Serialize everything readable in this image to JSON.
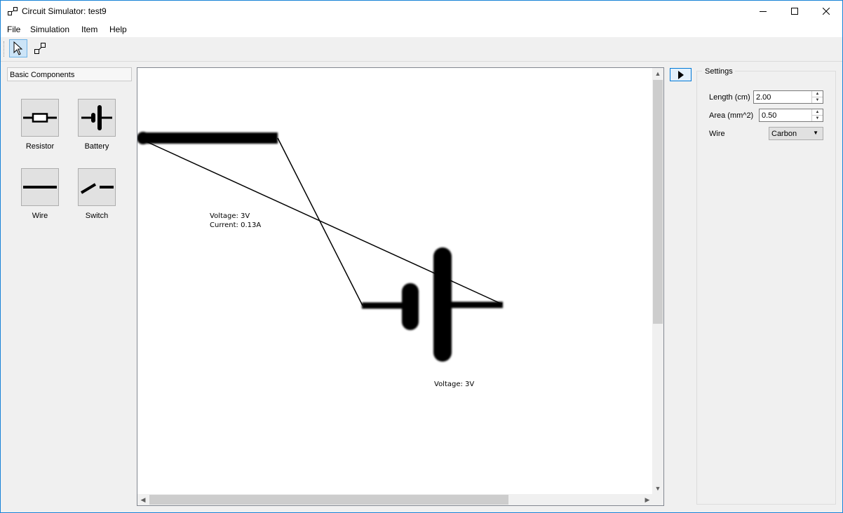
{
  "window": {
    "title": "Circuit Simulator: test9",
    "controls": [
      "minimize-icon",
      "maximize-icon",
      "close-icon"
    ]
  },
  "menu": {
    "items": [
      "File",
      "Simulation",
      "Item",
      "Help"
    ]
  },
  "toolbar": {
    "tools": [
      {
        "icon": "pointer-icon",
        "active": true
      },
      {
        "icon": "connect-icon",
        "active": false
      }
    ]
  },
  "components": {
    "header": "Basic Components",
    "items": [
      {
        "label": "Resistor",
        "icon": "resistor-icon"
      },
      {
        "label": "Battery",
        "icon": "battery-icon"
      },
      {
        "label": "Wire",
        "icon": "wire-icon"
      },
      {
        "label": "Switch",
        "icon": "switch-icon"
      }
    ]
  },
  "canvas": {
    "wire_label": {
      "voltage": "Voltage: 3V",
      "current": "Current: 0.13A"
    },
    "battery_label": {
      "voltage": "Voltage: 3V"
    }
  },
  "run_button": {
    "icon": "play-icon"
  },
  "settings": {
    "title": "Settings",
    "length_label": "Length (cm)",
    "length_value": "2.00",
    "area_label": "Area (mm^2)",
    "area_value": "0.50",
    "wire_label": "Wire",
    "wire_value": "Carbon"
  }
}
